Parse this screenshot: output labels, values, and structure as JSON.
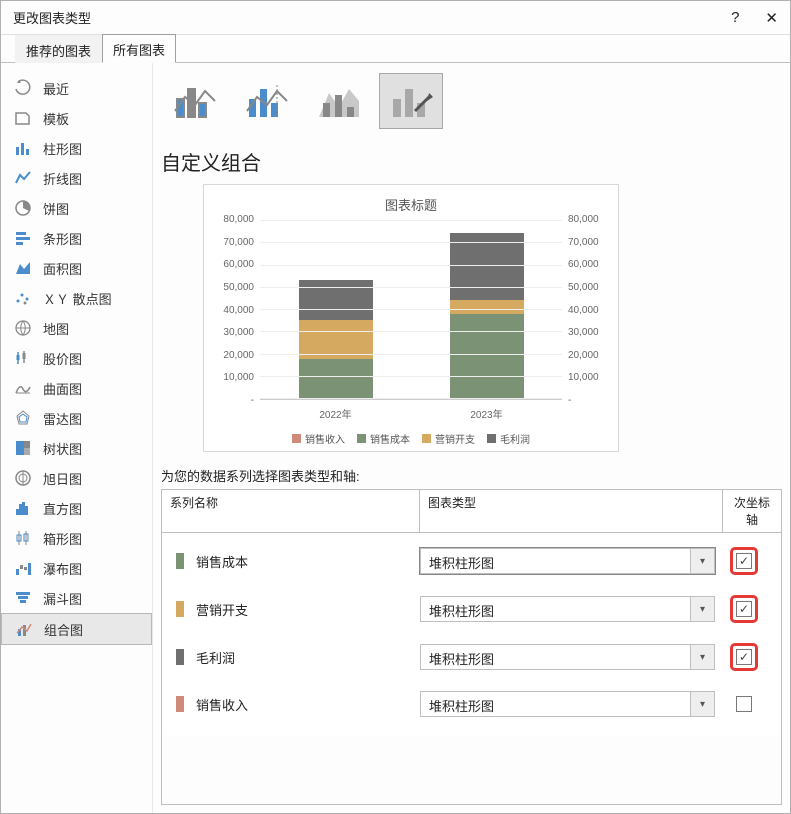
{
  "window": {
    "title": "更改图表类型",
    "help": "?",
    "close": "✕"
  },
  "tabs": {
    "recommended": "推荐的图表",
    "all": "所有图表"
  },
  "categories": [
    {
      "id": "recent",
      "label": "最近"
    },
    {
      "id": "template",
      "label": "模板"
    },
    {
      "id": "column",
      "label": "柱形图"
    },
    {
      "id": "line",
      "label": "折线图"
    },
    {
      "id": "pie",
      "label": "饼图"
    },
    {
      "id": "bar",
      "label": "条形图"
    },
    {
      "id": "area",
      "label": "面积图"
    },
    {
      "id": "scatter",
      "label": "ＸＹ 散点图"
    },
    {
      "id": "map",
      "label": "地图"
    },
    {
      "id": "stock",
      "label": "股价图"
    },
    {
      "id": "surface",
      "label": "曲面图"
    },
    {
      "id": "radar",
      "label": "雷达图"
    },
    {
      "id": "treemap",
      "label": "树状图"
    },
    {
      "id": "sunburst",
      "label": "旭日图"
    },
    {
      "id": "hist",
      "label": "直方图"
    },
    {
      "id": "box",
      "label": "箱形图"
    },
    {
      "id": "waterfall",
      "label": "瀑布图"
    },
    {
      "id": "funnel",
      "label": "漏斗图"
    },
    {
      "id": "combo",
      "label": "组合图"
    }
  ],
  "section_title": "自定义组合",
  "chart_data": {
    "type": "bar",
    "stacked": true,
    "title": "图表标题",
    "categories": [
      "2022年",
      "2023年"
    ],
    "series": [
      {
        "name": "销售成本",
        "color": "#7c9274",
        "values": [
          18000,
          38000
        ]
      },
      {
        "name": "营销开支",
        "color": "#d6a960",
        "values": [
          17000,
          6000
        ]
      },
      {
        "name": "毛利润",
        "color": "#6f6f6f",
        "values": [
          18000,
          30000
        ]
      }
    ],
    "totals": [
      53000,
      74000
    ],
    "ylabel": "",
    "ylim_left": [
      0,
      80000
    ],
    "ylim_right": [
      0,
      80000
    ],
    "ticks": [
      "80,000",
      "70,000",
      "60,000",
      "50,000",
      "40,000",
      "30,000",
      "20,000",
      "10,000",
      "-"
    ],
    "legend": [
      {
        "label": "销售收入",
        "color": "#d08a7a"
      },
      {
        "label": "销售成本",
        "color": "#7c9274"
      },
      {
        "label": "营销开支",
        "color": "#d6a960"
      },
      {
        "label": "毛利润",
        "color": "#6f6f6f"
      }
    ]
  },
  "series_caption": "为您的数据系列选择图表类型和轴:",
  "series_headers": {
    "name": "系列名称",
    "type": "图表类型",
    "axis": "次坐标轴"
  },
  "series_rows": [
    {
      "swatch": "#7c9274",
      "name": "销售成本",
      "type": "堆积柱形图",
      "checked": true,
      "highlight": true,
      "focus": true
    },
    {
      "swatch": "#d6a960",
      "name": "营销开支",
      "type": "堆积柱形图",
      "checked": true,
      "highlight": true,
      "focus": false
    },
    {
      "swatch": "#6f6f6f",
      "name": "毛利润",
      "type": "堆积柱形图",
      "checked": true,
      "highlight": true,
      "focus": false
    },
    {
      "swatch": "#d08a7a",
      "name": "销售收入",
      "type": "堆积柱形图",
      "checked": false,
      "highlight": false,
      "focus": false
    }
  ]
}
